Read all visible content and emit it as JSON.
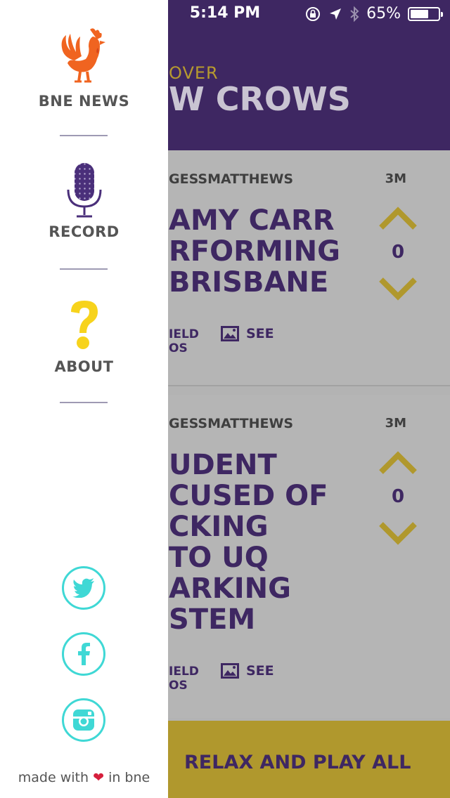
{
  "status_bar": {
    "time": "5:14 PM",
    "battery": "65%",
    "battery_level": 0.65
  },
  "header": {
    "subtitle": "OVER",
    "title": "W CROWS"
  },
  "drawer": {
    "logo_label": "BNE NEWS",
    "items": [
      {
        "label": "RECORD",
        "icon": "microphone-icon"
      },
      {
        "label": "ABOUT",
        "icon": "question-icon"
      }
    ],
    "social": [
      {
        "icon": "twitter-icon"
      },
      {
        "icon": "facebook-icon"
      },
      {
        "icon": "instagram-icon"
      }
    ],
    "made_with_prefix": "made with",
    "made_with_suffix": "in bne"
  },
  "cards": [
    {
      "author": "GESSMATTHEWS",
      "time": "3M",
      "title": "AMY CARR\nRFORMING\nBRISBANE",
      "votes": "0",
      "source": "IELD\nOS",
      "see": "SEE"
    },
    {
      "author": "GESSMATTHEWS",
      "time": "3M",
      "title": "UDENT\nCUSED OF\nCKING\nTO UQ\nARKING\nSTEM",
      "votes": "0",
      "source": "IELD\nOS",
      "see": "SEE"
    }
  ],
  "play_all": {
    "label": "RELAX AND PLAY ALL"
  },
  "colors": {
    "header_purple": "#3e2762",
    "gold": "#b0982d",
    "accent_orange": "#f06420",
    "accent_yellow": "#f7d31c",
    "social_cyan": "#3fd8d5",
    "heart_red": "#d61f3c"
  }
}
